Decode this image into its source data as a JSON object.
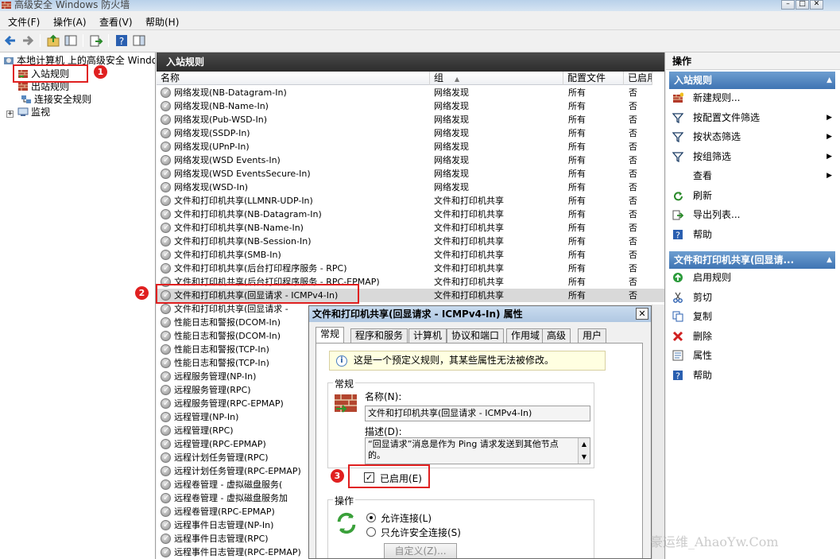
{
  "window": {
    "title": "高级安全 Windows 防火墙"
  },
  "menu": [
    "文件(F)",
    "操作(A)",
    "查看(V)",
    "帮助(H)"
  ],
  "tree": {
    "root": "本地计算机 上的高级安全 Windows 防火墙",
    "inbound": "入站规则",
    "outbound": "出站规则",
    "connsec": "连接安全规则",
    "monitor": "监视"
  },
  "middle": {
    "header": "入站规则",
    "columns": [
      "名称",
      "组",
      "配置文件",
      "已启用"
    ],
    "rows": [
      {
        "name": "网络发现(NB-Datagram-In)",
        "group": "网络发现",
        "profile": "所有",
        "enabled": "否"
      },
      {
        "name": "网络发现(NB-Name-In)",
        "group": "网络发现",
        "profile": "所有",
        "enabled": "否"
      },
      {
        "name": "网络发现(Pub-WSD-In)",
        "group": "网络发现",
        "profile": "所有",
        "enabled": "否"
      },
      {
        "name": "网络发现(SSDP-In)",
        "group": "网络发现",
        "profile": "所有",
        "enabled": "否"
      },
      {
        "name": "网络发现(UPnP-In)",
        "group": "网络发现",
        "profile": "所有",
        "enabled": "否"
      },
      {
        "name": "网络发现(WSD Events-In)",
        "group": "网络发现",
        "profile": "所有",
        "enabled": "否"
      },
      {
        "name": "网络发现(WSD EventsSecure-In)",
        "group": "网络发现",
        "profile": "所有",
        "enabled": "否"
      },
      {
        "name": "网络发现(WSD-In)",
        "group": "网络发现",
        "profile": "所有",
        "enabled": "否"
      },
      {
        "name": "文件和打印机共享(LLMNR-UDP-In)",
        "group": "文件和打印机共享",
        "profile": "所有",
        "enabled": "否"
      },
      {
        "name": "文件和打印机共享(NB-Datagram-In)",
        "group": "文件和打印机共享",
        "profile": "所有",
        "enabled": "否"
      },
      {
        "name": "文件和打印机共享(NB-Name-In)",
        "group": "文件和打印机共享",
        "profile": "所有",
        "enabled": "否"
      },
      {
        "name": "文件和打印机共享(NB-Session-In)",
        "group": "文件和打印机共享",
        "profile": "所有",
        "enabled": "否"
      },
      {
        "name": "文件和打印机共享(SMB-In)",
        "group": "文件和打印机共享",
        "profile": "所有",
        "enabled": "否"
      },
      {
        "name": "文件和打印机共享(后台打印程序服务 - RPC)",
        "group": "文件和打印机共享",
        "profile": "所有",
        "enabled": "否"
      },
      {
        "name": "文件和打印机共享(后台打印程序服务 - RPC-EPMAP)",
        "group": "文件和打印机共享",
        "profile": "所有",
        "enabled": "否"
      },
      {
        "name": "文件和打印机共享(回显请求 - ICMPv4-In)",
        "group": "文件和打印机共享",
        "profile": "所有",
        "enabled": "否"
      },
      {
        "name": "文件和打印机共享(回显请求 - ",
        "group": "",
        "profile": "",
        "enabled": ""
      },
      {
        "name": "性能日志和警报(DCOM-In)",
        "group": "",
        "profile": "",
        "enabled": ""
      },
      {
        "name": "性能日志和警报(DCOM-In)",
        "group": "",
        "profile": "",
        "enabled": ""
      },
      {
        "name": "性能日志和警报(TCP-In)",
        "group": "",
        "profile": "",
        "enabled": ""
      },
      {
        "name": "性能日志和警报(TCP-In)",
        "group": "",
        "profile": "",
        "enabled": ""
      },
      {
        "name": "远程服务管理(NP-In)",
        "group": "",
        "profile": "",
        "enabled": ""
      },
      {
        "name": "远程服务管理(RPC)",
        "group": "",
        "profile": "",
        "enabled": ""
      },
      {
        "name": "远程服务管理(RPC-EPMAP)",
        "group": "",
        "profile": "",
        "enabled": ""
      },
      {
        "name": "远程管理(NP-In)",
        "group": "",
        "profile": "",
        "enabled": ""
      },
      {
        "name": "远程管理(RPC)",
        "group": "",
        "profile": "",
        "enabled": ""
      },
      {
        "name": "远程管理(RPC-EPMAP)",
        "group": "",
        "profile": "",
        "enabled": ""
      },
      {
        "name": "远程计划任务管理(RPC)",
        "group": "",
        "profile": "",
        "enabled": ""
      },
      {
        "name": "远程计划任务管理(RPC-EPMAP)",
        "group": "",
        "profile": "",
        "enabled": ""
      },
      {
        "name": "远程卷管理 - 虚拟磁盘服务(",
        "group": "",
        "profile": "",
        "enabled": ""
      },
      {
        "name": "远程卷管理 - 虚拟磁盘服务加",
        "group": "",
        "profile": "",
        "enabled": ""
      },
      {
        "name": "远程卷管理(RPC-EPMAP)",
        "group": "",
        "profile": "",
        "enabled": ""
      },
      {
        "name": "远程事件日志管理(NP-In)",
        "group": "",
        "profile": "",
        "enabled": ""
      },
      {
        "name": "远程事件日志管理(RPC)",
        "group": "",
        "profile": "",
        "enabled": ""
      },
      {
        "name": "远程事件日志管理(RPC-EPMAP)",
        "group": "",
        "profile": "",
        "enabled": ""
      }
    ]
  },
  "actions": {
    "header": "操作",
    "section1": "入站规则",
    "items1": [
      {
        "label": "新建规则...",
        "icon": "new-rule-icon",
        "sub": false
      },
      {
        "label": "按配置文件筛选",
        "icon": "filter-icon",
        "sub": true
      },
      {
        "label": "按状态筛选",
        "icon": "filter-icon",
        "sub": true
      },
      {
        "label": "按组筛选",
        "icon": "filter-icon",
        "sub": true
      },
      {
        "label": "查看",
        "icon": "",
        "sub": true
      },
      {
        "label": "刷新",
        "icon": "refresh-icon",
        "sub": false
      },
      {
        "label": "导出列表...",
        "icon": "export-icon",
        "sub": false
      },
      {
        "label": "帮助",
        "icon": "help-icon",
        "sub": false
      }
    ],
    "section2": "文件和打印机共享(回显请...",
    "items2": [
      {
        "label": "启用规则",
        "icon": "enable-icon"
      },
      {
        "label": "剪切",
        "icon": "cut-icon"
      },
      {
        "label": "复制",
        "icon": "copy-icon"
      },
      {
        "label": "删除",
        "icon": "delete-icon"
      },
      {
        "label": "属性",
        "icon": "properties-icon"
      },
      {
        "label": "帮助",
        "icon": "help-icon"
      }
    ]
  },
  "dialog": {
    "title": "文件和打印机共享(回显请求 - ICMPv4-In) 属性",
    "tabs": [
      "常规",
      "程序和服务",
      "计算机",
      "协议和端口",
      "作用域",
      "高级",
      "用户"
    ],
    "info": "这是一个预定义规则，其某些属性无法被修改。",
    "general_label": "常规",
    "name_label": "名称(N):",
    "name_value": "文件和打印机共享(回显请求 - ICMPv4-In)",
    "desc_label": "描述(D):",
    "desc_value": "“回显请求”消息是作为 Ping 请求发送到其他节点的。",
    "enabled_label": "已启用(E)",
    "action_label": "操作",
    "allow": "允许连接(L)",
    "allow_secure": "只允许安全连接(S)",
    "custom": "自定义(Z)..."
  },
  "annotations": [
    "1",
    "2",
    "3"
  ],
  "watermark": "豪运维_AhaoYw.Com",
  "colors": {
    "accent": "#e02020",
    "header_dark": "#2c2c2c",
    "section_blue": "#3f74b3"
  }
}
